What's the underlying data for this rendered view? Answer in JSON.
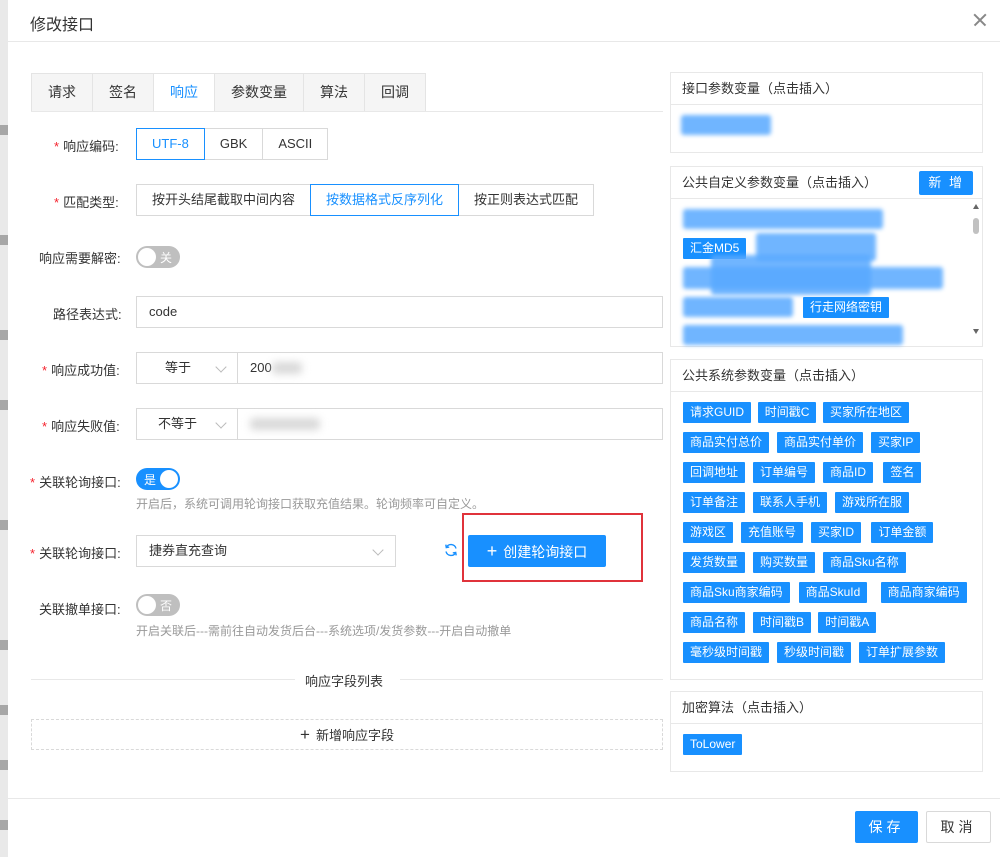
{
  "dialog": {
    "title": "修改接口"
  },
  "tabs": [
    {
      "label": "请求"
    },
    {
      "label": "签名"
    },
    {
      "label": "响应"
    },
    {
      "label": "参数变量"
    },
    {
      "label": "算法"
    },
    {
      "label": "回调"
    }
  ],
  "active_tab": "响应",
  "form": {
    "encoding": {
      "label": "响应编码:",
      "options": [
        "UTF-8",
        "GBK",
        "ASCII"
      ],
      "selected": "UTF-8"
    },
    "match_type": {
      "label": "匹配类型:",
      "options": [
        "按开头结尾截取中间内容",
        "按数据格式反序列化",
        "按正则表达式匹配"
      ],
      "selected": "按数据格式反序列化"
    },
    "decrypt": {
      "label": "响应需要解密:",
      "state": "关"
    },
    "path": {
      "label": "路径表达式:",
      "value": "code"
    },
    "success": {
      "label": "响应成功值:",
      "operator": "等于",
      "value": "200"
    },
    "fail": {
      "label": "响应失败值:",
      "operator": "不等于",
      "value": ""
    },
    "poll": {
      "label": "关联轮询接口:",
      "state": "是",
      "hint": "开启后，系统可调用轮询接口获取充值结果。轮询频率可自定义。"
    },
    "poll_select": {
      "label": "关联轮询接口:",
      "value": "捷券直充查询"
    },
    "create_poll_button": "创建轮询接口",
    "cancel_order": {
      "label": "关联撤单接口:",
      "state": "否",
      "hint": "开启关联后---需前往自动发货后台---系统选项/发货参数---开启自动撤单"
    },
    "fields_divider": "响应字段列表",
    "add_field_button": "新增响应字段"
  },
  "right": {
    "interface_vars": {
      "title": "接口参数变量（点击插入）"
    },
    "custom_vars": {
      "title": "公共自定义参数变量（点击插入）",
      "add_label": "新 增",
      "visible_fragments": [
        "汇金MD5",
        "行走网络密钥"
      ]
    },
    "system_vars": {
      "title": "公共系统参数变量（点击插入）",
      "rows": [
        [
          "请求GUID",
          "时间戳C",
          "买家所在地区"
        ],
        [
          "商品实付总价",
          "商品实付单价",
          "买家IP"
        ],
        [
          "回调地址",
          "订单编号",
          "商品ID",
          "签名"
        ],
        [
          "订单备注",
          "联系人手机",
          "游戏所在服"
        ],
        [
          "游戏区",
          "充值账号",
          "买家ID",
          "订单金额"
        ],
        [
          "发货数量",
          "购买数量",
          "商品Sku名称"
        ],
        [
          "商品Sku商家编码",
          "商品SkuId",
          "商品商家编码"
        ],
        [
          "商品名称",
          "时间戳B",
          "时间戳A"
        ],
        [
          "毫秒级时间戳",
          "秒级时间戳",
          "订单扩展参数"
        ]
      ]
    },
    "algorithms": {
      "title": "加密算法（点击插入）",
      "items": [
        "ToLower"
      ]
    }
  },
  "footer": {
    "save": "保存",
    "cancel": "取消"
  },
  "colors": {
    "primary": "#1890ff",
    "required": "#f5222d",
    "annotation": "#e0333b"
  }
}
